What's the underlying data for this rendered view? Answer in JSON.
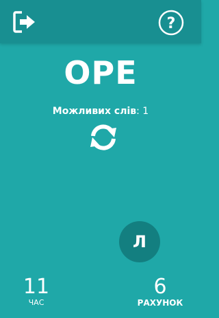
{
  "header": {
    "exit_icon": "exit-icon",
    "help_icon": "help-icon",
    "help_glyph": "?"
  },
  "game": {
    "word": "ОРЕ",
    "possible_label": "Можливих слів",
    "possible_count": ": 1",
    "refresh_icon": "refresh-icon",
    "letters": [
      "Л"
    ]
  },
  "stats": {
    "time_value": "11",
    "time_label": "ЧАС",
    "score_value": "6",
    "score_label": "РАХУНОК"
  },
  "colors": {
    "background": "#1fa8a8",
    "header": "#188f91",
    "tile": "#137f80",
    "text": "#ffffff"
  }
}
